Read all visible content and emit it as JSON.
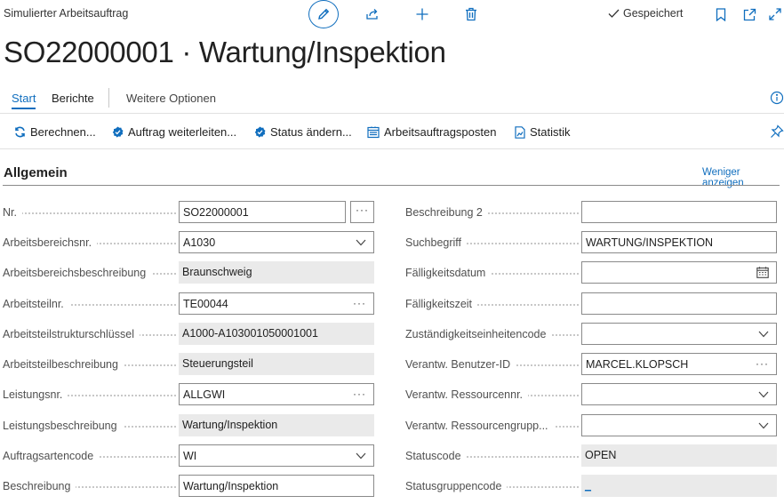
{
  "app": {
    "page_caption": "Simulierter Arbeitsauftrag",
    "saved_label": "Gespeichert",
    "title": "SO22000001 · Wartung/Inspektion"
  },
  "tabs": {
    "start": "Start",
    "berichte": "Berichte",
    "weitere": "Weitere Optionen"
  },
  "actions": {
    "berechnen": "Berechnen...",
    "weiterleiten": "Auftrag weiterleiten...",
    "status": "Status ändern...",
    "posten": "Arbeitsauftragsposten",
    "statistik": "Statistik"
  },
  "section": {
    "title": "Allgemein",
    "less_link": "Weniger anzeigen"
  },
  "left_fields": [
    {
      "label": "Nr.",
      "value": "SO22000001"
    },
    {
      "label": "Arbeitsbereichsnr.",
      "value": "A1030"
    },
    {
      "label": "Arbeitsbereichsbeschreibung",
      "value": "Braunschweig"
    },
    {
      "label": "Arbeitsteilnr.",
      "value": "TE00044"
    },
    {
      "label": "Arbeitsteilstrukturschlüssel",
      "value": "A1000-A103001050001001"
    },
    {
      "label": "Arbeitsteilbeschreibung",
      "value": "Steuerungsteil"
    },
    {
      "label": "Leistungsnr.",
      "value": "ALLGWI"
    },
    {
      "label": "Leistungsbeschreibung",
      "value": "Wartung/Inspektion"
    },
    {
      "label": "Auftragsartencode",
      "value": "WI"
    },
    {
      "label": "Beschreibung",
      "value": "Wartung/Inspektion"
    }
  ],
  "right_fields": [
    {
      "label": "Beschreibung 2",
      "value": ""
    },
    {
      "label": "Suchbegriff",
      "value": "WARTUNG/INSPEKTION"
    },
    {
      "label": "Fälligkeitsdatum",
      "value": ""
    },
    {
      "label": "Fälligkeitszeit",
      "value": ""
    },
    {
      "label": "Zuständigkeitseinheitencode",
      "value": ""
    },
    {
      "label": "Verantw. Benutzer-ID",
      "value": "MARCEL.KLOPSCH"
    },
    {
      "label": "Verantw. Ressourcennr.",
      "value": ""
    },
    {
      "label": "Verantw. Ressourcengrupp...",
      "value": ""
    },
    {
      "label": "Statuscode",
      "value": "OPEN"
    },
    {
      "label": "Statusgruppencode",
      "value": "_"
    }
  ],
  "icons": {
    "edit": "pencil-icon",
    "share": "share-icon",
    "new": "plus-icon",
    "delete": "trash-icon",
    "saved": "checkmark-icon",
    "bookmark": "bookmark-icon",
    "popout": "open-in-new-window-icon",
    "expand": "expand-icon",
    "info": "info-icon",
    "pin": "pin-icon",
    "lookup": "ellipsis-icon",
    "dropdown": "chevron-down-icon",
    "calendar": "calendar-icon"
  },
  "colors": {
    "accent": "#106ebe",
    "readonly_bg": "#eaeaea"
  }
}
